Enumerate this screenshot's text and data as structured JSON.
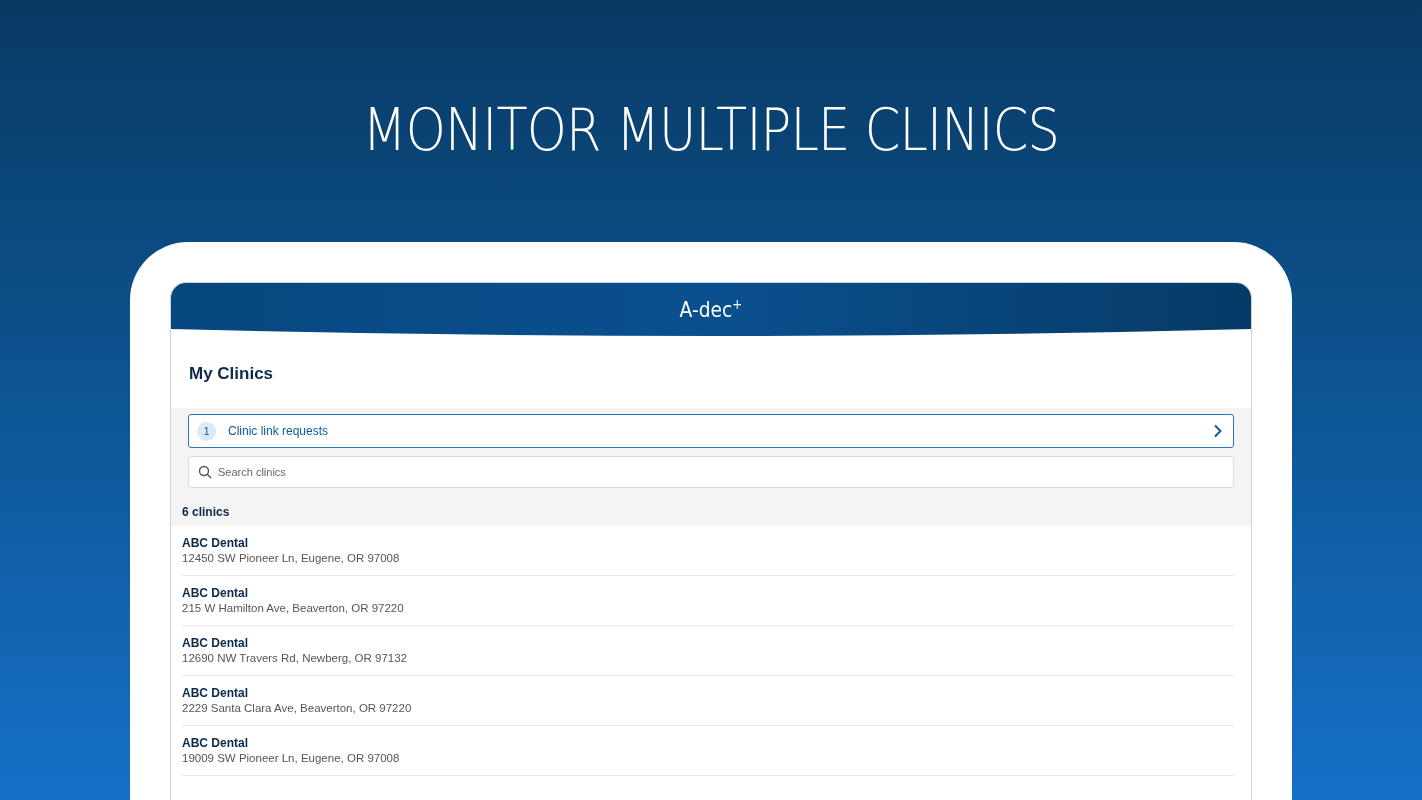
{
  "headline": "MONITOR MULTIPLE CLINICS",
  "app_header": {
    "logo": "A-dec$^{+}$"
  },
  "page_title": "My Clinics",
  "link_requests": {
    "count": "1",
    "label": "Clinic link requests"
  },
  "search": {
    "placeholder": "Search clinics"
  },
  "clinic_count": "6 clinics",
  "clinics": [
    {
      "name": "ABC Dental",
      "address": "12450 SW Pioneer Ln, Eugene, OR 97008"
    },
    {
      "name": "ABC Dental",
      "address": "215 W Hamilton Ave, Beaverton, OR 97220"
    },
    {
      "name": "ABC Dental",
      "address": "12690 NW Travers Rd, Newberg, OR 97132"
    },
    {
      "name": "ABC Dental",
      "address": "2229 Santa Clara Ave, Beaverton, OR 97220"
    },
    {
      "name": "ABC Dental",
      "address": "19009 SW Pioneer Ln, Eugene, OR 97008"
    }
  ]
}
